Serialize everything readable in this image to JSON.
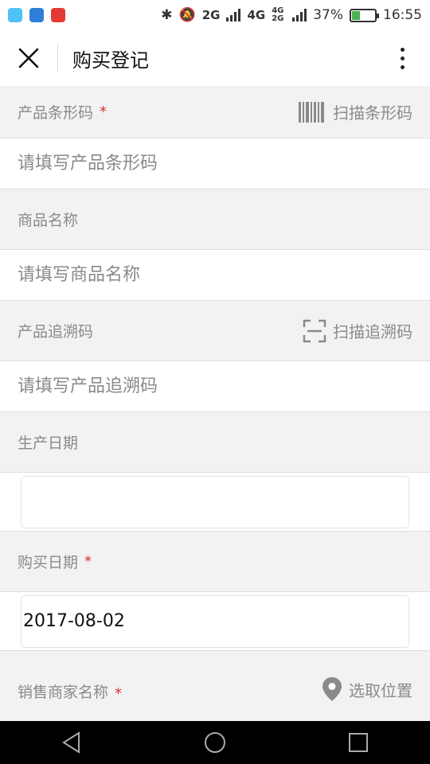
{
  "status_bar": {
    "network_primary": "4G",
    "network_secondary": "4G 2G",
    "network_2g": "2G",
    "battery_percent": "37%",
    "battery_level": 0.37,
    "time": "16:55"
  },
  "header": {
    "title": "购买登记"
  },
  "form": {
    "barcode": {
      "label": "产品条形码",
      "required_mark": "*",
      "scan_label": "扫描条形码",
      "placeholder": "请填写产品条形码",
      "value": ""
    },
    "product_name": {
      "label": "商品名称",
      "placeholder": "请填写商品名称",
      "value": ""
    },
    "trace_code": {
      "label": "产品追溯码",
      "scan_label": "扫描追溯码",
      "placeholder": "请填写产品追溯码",
      "value": ""
    },
    "production_date": {
      "label": "生产日期",
      "value": ""
    },
    "purchase_date": {
      "label": "购买日期",
      "required_mark": "*",
      "value": "2017-08-02"
    },
    "merchant_name": {
      "label": "销售商家名称",
      "required_mark": "*",
      "location_label": "选取位置"
    }
  },
  "colors": {
    "required": "#d9302c",
    "label_gray": "#8a8a8a",
    "background": "#f2f2f2"
  }
}
